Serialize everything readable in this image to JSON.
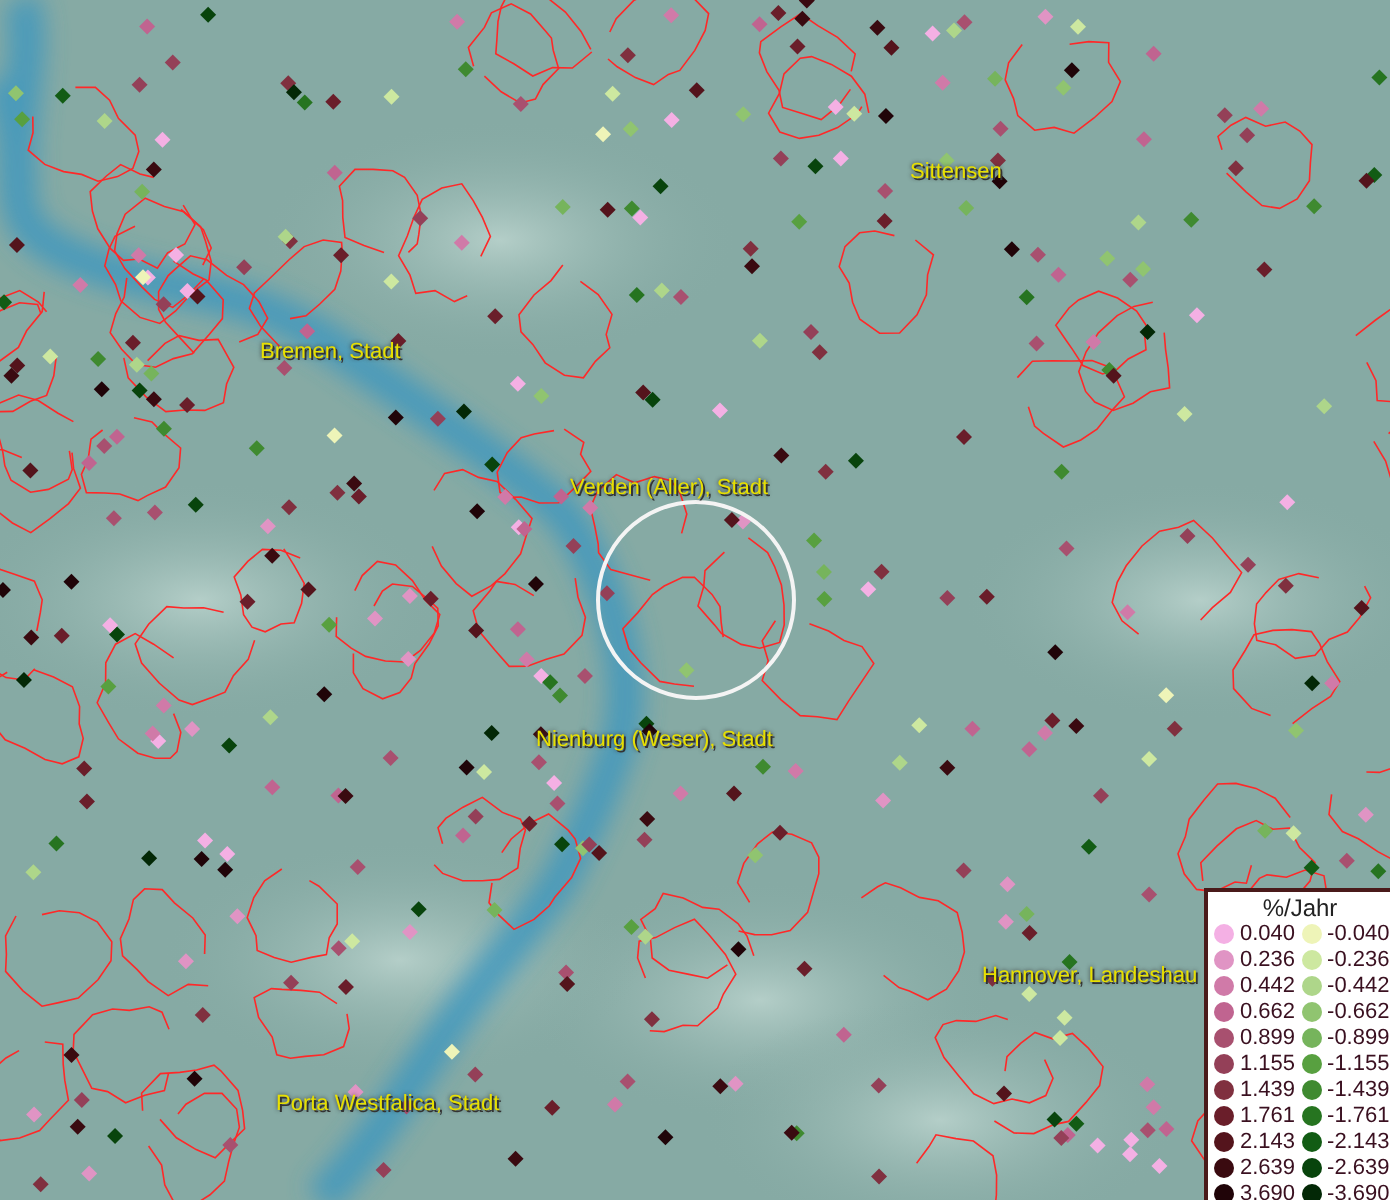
{
  "map": {
    "place_labels": [
      {
        "text": "Sittensen"
      },
      {
        "text": "Bremen, Stadt"
      },
      {
        "text": "Verden (Aller), Stadt"
      },
      {
        "text": "Nienburg (Weser), Stadt"
      },
      {
        "text": "Hannover, Landeshau"
      },
      {
        "text": "Porta Westfalica, Stadt"
      }
    ]
  },
  "legend": {
    "title": "%/Jahr",
    "rows": [
      {
        "positive": {
          "value": "0.040",
          "color": "#f4b0e4"
        },
        "negative": {
          "value": "-0.040",
          "color": "#eef4b8"
        }
      },
      {
        "positive": {
          "value": "0.236",
          "color": "#e094c4"
        },
        "negative": {
          "value": "-0.236",
          "color": "#cde8a0"
        }
      },
      {
        "positive": {
          "value": "0.442",
          "color": "#d07aa8"
        },
        "negative": {
          "value": "-0.442",
          "color": "#aed68a"
        }
      },
      {
        "positive": {
          "value": "0.662",
          "color": "#c06490"
        },
        "negative": {
          "value": "-0.662",
          "color": "#90c470"
        }
      },
      {
        "positive": {
          "value": "0.899",
          "color": "#a8506f"
        },
        "negative": {
          "value": "-0.899",
          "color": "#76b45c"
        }
      },
      {
        "positive": {
          "value": "1.155",
          "color": "#944058"
        },
        "negative": {
          "value": "-1.155",
          "color": "#58a040"
        }
      },
      {
        "positive": {
          "value": "1.439",
          "color": "#80303f"
        },
        "negative": {
          "value": "-1.439",
          "color": "#3f8a30"
        }
      },
      {
        "positive": {
          "value": "1.761",
          "color": "#6a1e2a"
        },
        "negative": {
          "value": "-1.761",
          "color": "#267420"
        }
      },
      {
        "positive": {
          "value": "2.143",
          "color": "#54141c"
        },
        "negative": {
          "value": "-2.143",
          "color": "#125c14"
        }
      },
      {
        "positive": {
          "value": "2.639",
          "color": "#3a0a10"
        },
        "negative": {
          "value": "-2.639",
          "color": "#08440c"
        }
      },
      {
        "positive": {
          "value": "3.690",
          "color": "#200408"
        },
        "negative": {
          "value": "-3.690",
          "color": "#032806"
        }
      }
    ]
  }
}
